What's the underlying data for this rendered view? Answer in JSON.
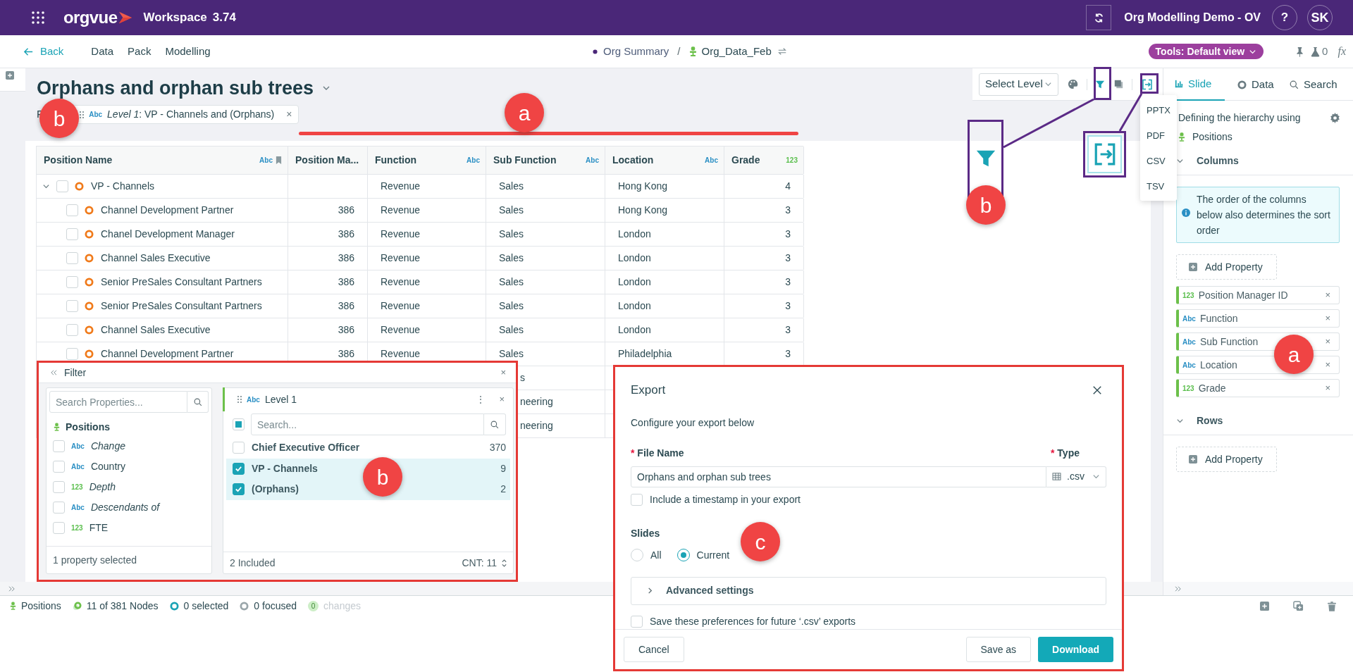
{
  "app_bar": {
    "brand": "orgvue",
    "workspace": "Workspace",
    "version": "3.74",
    "project": "Org Modelling Demo - OV",
    "help": "?",
    "user": "SK"
  },
  "nav": {
    "back": "Back",
    "menu": [
      "Data",
      "Pack",
      "Modelling"
    ],
    "breadcrumb": [
      {
        "label": "Org Summary",
        "kind": "summary"
      },
      {
        "label": "Org_Data_Feb",
        "kind": "dataset"
      }
    ],
    "separator": "/",
    "tools": "Tools: Default view",
    "lab_count": "0",
    "formula": "fx"
  },
  "slide": {
    "title": "Orphans and orphan sub trees",
    "filter_label": "F",
    "filter_chip": {
      "badge": "Abc",
      "kind": "text",
      "text": "*Level 1*: VP - Channels and (Orphans)",
      "remove": "×"
    }
  },
  "toolbar": {
    "select_level": "Select Level",
    "export_menu": [
      "PPTX",
      "PDF",
      "CSV",
      "TSV"
    ]
  },
  "table": {
    "columns": [
      {
        "label": "Position Name",
        "badge": "Abc",
        "kind": "text"
      },
      {
        "label": "Position Ma..."
      },
      {
        "label": "Function",
        "badge": "Abc",
        "kind": "text"
      },
      {
        "label": "Sub Function",
        "badge": "Abc",
        "kind": "text"
      },
      {
        "label": "Location",
        "badge": "Abc",
        "kind": "text"
      },
      {
        "label": "Grade",
        "badge": "123",
        "kind": "number"
      }
    ],
    "rows": [
      {
        "name": "VP - Channels",
        "function": "Revenue",
        "sub_function": "Sales",
        "location": "Hong Kong",
        "grade": "4",
        "checked": false,
        "expanded": true,
        "children": [
          {
            "name": "Channel Development Partner",
            "manager": "386",
            "function": "Revenue",
            "sub_function": "Sales",
            "location": "Hong Kong",
            "grade": "3",
            "checked": false
          },
          {
            "name": "Chanel Development Manager",
            "manager": "386",
            "function": "Revenue",
            "sub_function": "Sales",
            "location": "London",
            "grade": "3",
            "checked": false
          },
          {
            "name": "Channel Sales Executive",
            "manager": "386",
            "function": "Revenue",
            "sub_function": "Sales",
            "location": "London",
            "grade": "3",
            "checked": false
          },
          {
            "name": "Senior PreSales Consultant Partners",
            "manager": "386",
            "function": "Revenue",
            "sub_function": "Sales",
            "location": "London",
            "grade": "3",
            "checked": false
          },
          {
            "name": "Senior PreSales Consultant Partners",
            "manager": "386",
            "function": "Revenue",
            "sub_function": "Sales",
            "location": "London",
            "grade": "3",
            "checked": false
          },
          {
            "name": "Channel Sales Executive",
            "manager": "386",
            "function": "Revenue",
            "sub_function": "Sales",
            "location": "London",
            "grade": "3",
            "checked": false
          },
          {
            "name": "Channel Development Partner",
            "manager": "386",
            "function": "Revenue",
            "sub_function": "Sales",
            "location": "Philadelphia",
            "grade": "3",
            "checked": false
          }
        ]
      }
    ],
    "covered_rows": [
      {
        "sub_function": "s"
      },
      {
        "sub_function": "neering"
      },
      {
        "sub_function": "neering"
      }
    ]
  },
  "filter_panel": {
    "title": "Filter",
    "close": "×",
    "properties": {
      "search_placeholder": "Search Properties...",
      "group": "Positions",
      "items": [
        {
          "badge": "Abc",
          "kind": "text",
          "label": "Change",
          "calculated": true,
          "checked": false
        },
        {
          "badge": "Abc",
          "kind": "text",
          "label": "Country",
          "calculated": false,
          "checked": false
        },
        {
          "badge": "123",
          "kind": "number",
          "label": "Depth",
          "calculated": true,
          "checked": false
        },
        {
          "badge": "Abc",
          "kind": "text",
          "label": "Descendants of",
          "calculated": true,
          "checked": false
        },
        {
          "badge": "123",
          "kind": "number",
          "label": "FTE",
          "calculated": false,
          "checked": false
        }
      ],
      "footer": "1 property selected"
    },
    "level": {
      "badge": "Abc",
      "kind": "text",
      "title": "Level 1",
      "menu": "⋮",
      "close": "×",
      "select_all_checked": false,
      "select_all_partial": true,
      "search_placeholder": "Search...",
      "values": [
        {
          "label": "Chief Executive Officer",
          "count": "370",
          "checked": false
        },
        {
          "label": "VP - Channels",
          "count": "9",
          "checked": true
        },
        {
          "label": "(Orphans)",
          "count": "2",
          "checked": true
        }
      ],
      "included": "2 Included",
      "count": "CNT: 11"
    }
  },
  "export_dialog": {
    "title": "Export",
    "subtitle": "Configure your export below",
    "file_name": {
      "required": "*",
      "label": "File Name",
      "value": "Orphans and orphan sub trees"
    },
    "type": {
      "required": "*",
      "label": "Type",
      "value": ".csv"
    },
    "timestamp": {
      "label": "Include a timestamp in your export",
      "checked": false
    },
    "slides": {
      "label": "Slides",
      "options": [
        {
          "label": "All",
          "selected": false
        },
        {
          "label": "Current",
          "selected": true
        }
      ]
    },
    "advanced": {
      "label": "Advanced settings",
      "expanded": false
    },
    "save_preferences": {
      "label": "Save these preferences for future ‘.csv’ exports",
      "checked": false
    },
    "buttons": [
      {
        "label": "Cancel",
        "kind": "secondary"
      },
      {
        "label": "Save as",
        "kind": "secondary"
      },
      {
        "label": "Download",
        "kind": "primary"
      }
    ]
  },
  "right_panel": {
    "tabs": [
      {
        "label": "Slide",
        "kind": "slide",
        "selected": true
      },
      {
        "label": "Data",
        "kind": "data",
        "selected": false
      },
      {
        "label": "Search",
        "kind": "search",
        "selected": false
      }
    ],
    "hierarchy_label": "Defining the hierarchy using",
    "hierarchy_source": "Positions",
    "sections": [
      {
        "title": "Columns",
        "expanded": true,
        "info": "The order of the columns below also determines the sort order",
        "add": "Add Property",
        "properties": [
          {
            "badge": "123",
            "kind": "number",
            "label": "Position Manager ID",
            "remove": "×"
          },
          {
            "badge": "Abc",
            "kind": "text",
            "label": "Function",
            "remove": "×"
          },
          {
            "badge": "Abc",
            "kind": "text",
            "label": "Sub Function",
            "remove": "×"
          },
          {
            "badge": "Abc",
            "kind": "text",
            "label": "Location",
            "remove": "×"
          },
          {
            "badge": "123",
            "kind": "number",
            "label": "Grade",
            "remove": "×"
          }
        ]
      },
      {
        "title": "Rows",
        "expanded": true,
        "add": "Add Property"
      }
    ]
  },
  "status_bar": {
    "items": [
      {
        "label": "Positions",
        "kind": "source",
        "disabled": false
      },
      {
        "label": "11 of 381 Nodes",
        "kind": "nodes",
        "disabled": false
      },
      {
        "label": "0 selected",
        "kind": "selected",
        "disabled": false
      },
      {
        "label": "0 focused",
        "kind": "focused",
        "disabled": false
      },
      {
        "badge": "0",
        "label": "changes",
        "kind": "changes",
        "disabled": true
      }
    ]
  },
  "annotations": {
    "callouts": [
      "b",
      "a",
      "b",
      "b",
      "c",
      "a"
    ]
  }
}
